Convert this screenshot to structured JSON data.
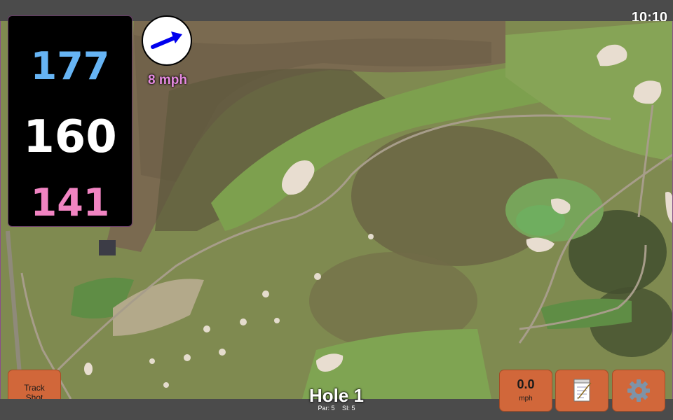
{
  "status": {
    "time": "10:10"
  },
  "distances": {
    "back": "177",
    "center": "160",
    "front": "141"
  },
  "wind": {
    "speed_label": "8 mph"
  },
  "buttons": {
    "track_shot_line1": "Track",
    "track_shot_line2": "Shot",
    "speed_value": "0.0",
    "speed_unit": "mph",
    "notes_icon": "notepad-icon",
    "settings_icon": "gear-icon"
  },
  "hole": {
    "title": "Hole 1",
    "par": "Par: 5",
    "si": "SI: 5"
  },
  "colors": {
    "back_distance": "#66b4f4",
    "center_distance": "#ffffff",
    "front_distance": "#f184c2",
    "wind_label": "#e58ae0",
    "button": "#d1673a",
    "wind_arrow": "#0000ee"
  }
}
